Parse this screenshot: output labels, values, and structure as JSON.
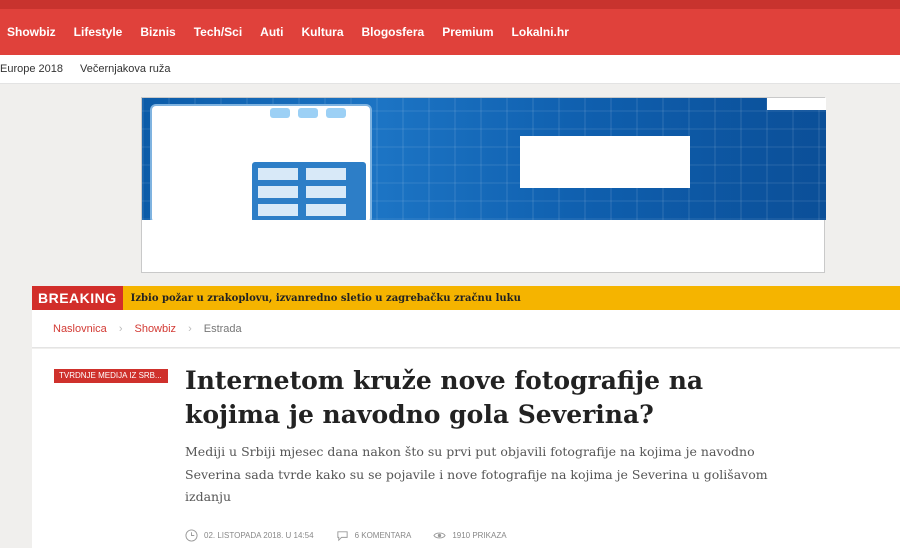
{
  "nav": {
    "items": [
      "Showbiz",
      "Lifestyle",
      "Biznis",
      "Tech/Sci",
      "Auti",
      "Kultura",
      "Blogosfera",
      "Premium",
      "Lokalni.hr"
    ]
  },
  "subnav": {
    "items": [
      "Europe 2018",
      "Večernjakova ruža"
    ]
  },
  "breaking": {
    "label": "BREAKING",
    "text": "Izbio požar u zrakoplovu, izvanredno sletio u zagrebačku zračnu luku"
  },
  "breadcrumb": {
    "items": [
      "Naslovnica",
      "Showbiz",
      "Estrada"
    ]
  },
  "article": {
    "tag": "TVRDNJE MEDIJA IZ SRB...",
    "headline": "Internetom kruže nove fotografije na kojima je navodno gola Severina?",
    "lede": "Mediji u Srbiji mjesec dana nakon što su prvi put objavili fotografije na kojima je navodno Severina sada tvrde kako su se pojavile i nove fotografije na kojima je Severina u golišavom izdanju",
    "date": "02. LISTOPADA 2018. U 14:54",
    "comments": "6 KOMENTARA",
    "views": "1910 PRIKAZA"
  },
  "colors": {
    "brand_red": "#e0413b",
    "breaking_yellow": "#f5b400",
    "breaking_red": "#d22e2a"
  },
  "icons": {
    "date": "clock-icon",
    "comments": "comment-bubble-icon",
    "views": "eye-icon"
  }
}
